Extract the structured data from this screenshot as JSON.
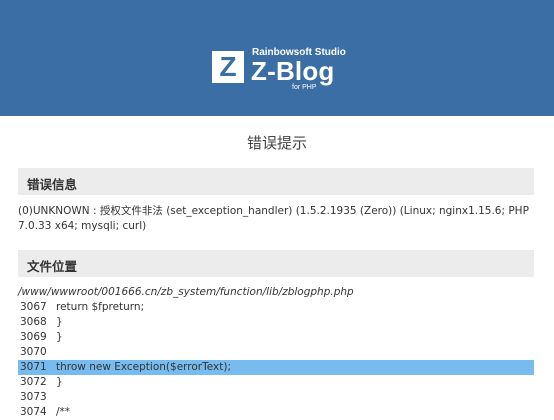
{
  "header": {
    "logo_mark": "Z",
    "studio": "Rainbowsoft Studio",
    "product": "Z-Blog",
    "sub": "for PHP"
  },
  "page_title": "错误提示",
  "error_info": {
    "heading": "错误信息",
    "message": "(0)UNKNOWN : 授权文件非法 (set_exception_handler) (1.5.2.1935 (Zero)) (Linux; nginx1.15.6; PHP 7.0.33 x64; mysqli; curl)"
  },
  "file_location": {
    "heading": "文件位置",
    "path": "/www/wwwroot/001666.cn/zb_system/function/lib/zblogphp.php",
    "lines": [
      {
        "num": "3067",
        "code": "return $fpreturn;"
      },
      {
        "num": "3068",
        "code": "}"
      },
      {
        "num": "3069",
        "code": "}"
      },
      {
        "num": "3070",
        "code": ""
      },
      {
        "num": "3071",
        "code": "throw new Exception($errorText);"
      },
      {
        "num": "3072",
        "code": "}"
      },
      {
        "num": "3073",
        "code": ""
      },
      {
        "num": "3074",
        "code": "/**"
      }
    ],
    "highlighted_line": "3071",
    "highlight_color": "#77bbef"
  },
  "colors": {
    "header_bg": "#3a6ea5",
    "section_bg": "#ececec"
  }
}
